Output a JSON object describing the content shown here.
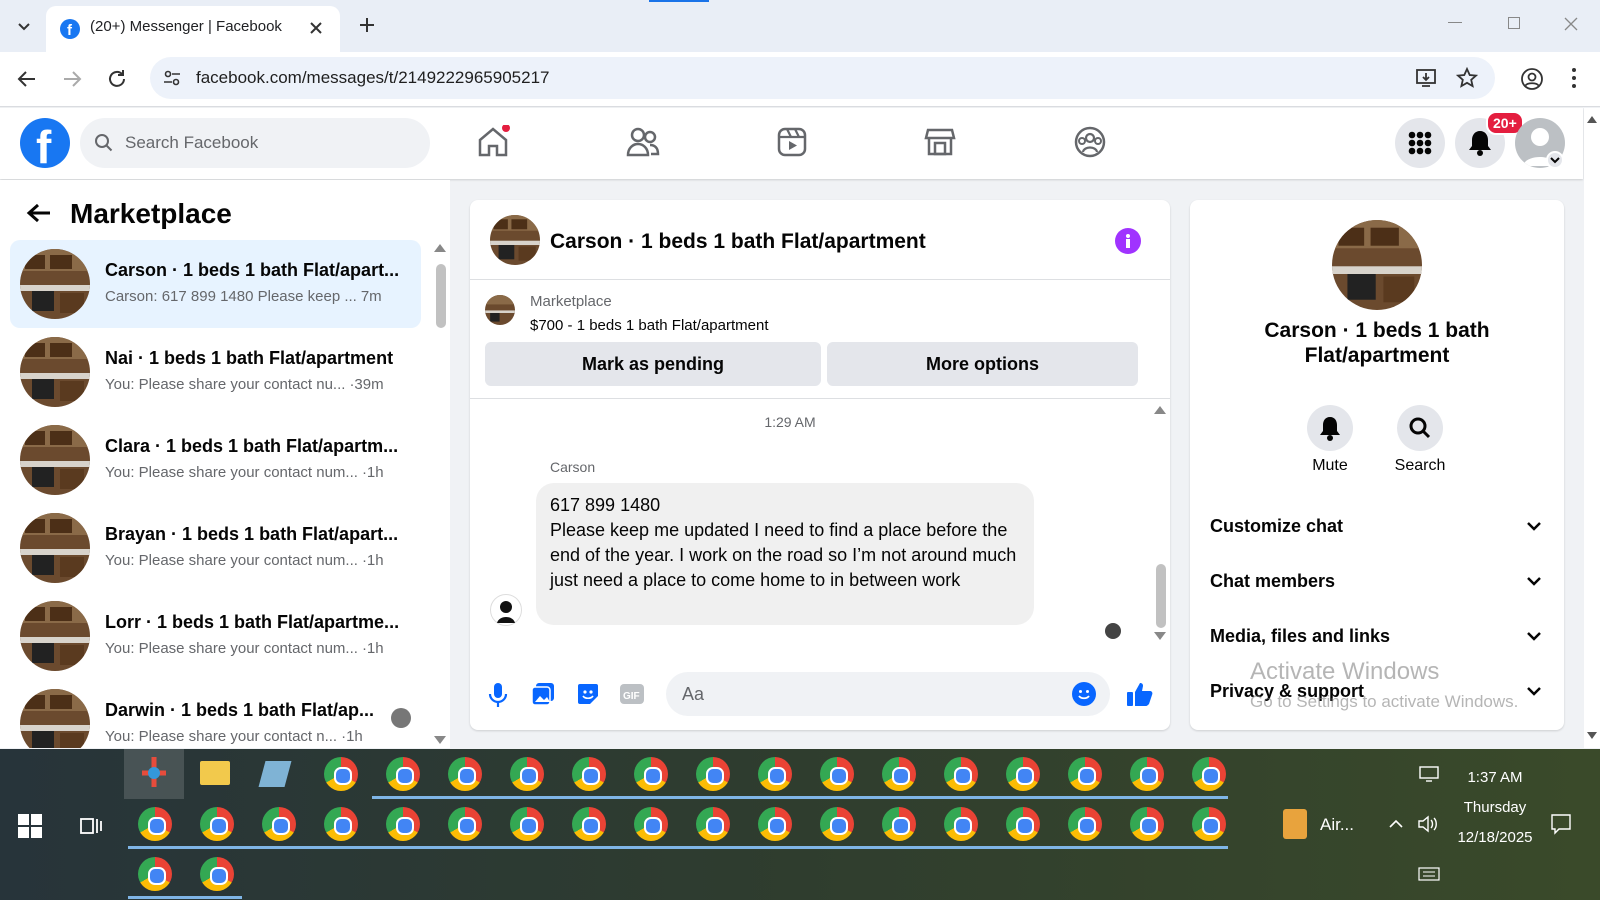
{
  "browser": {
    "tab_title": "(20+) Messenger | Facebook",
    "url": "facebook.com/messages/t/2149222965905217"
  },
  "fb": {
    "search_placeholder": "Search Facebook",
    "notif_badge": "20+",
    "brand_color": "#1877f2"
  },
  "left": {
    "heading": "Marketplace",
    "conversations": [
      {
        "name": "Carson · 1 beds 1 bath Flat/apart...",
        "preview": "Carson: 617 899 1480 Please keep ...",
        "time": "7m"
      },
      {
        "name": "Nai · 1 beds 1 bath Flat/apartment",
        "preview": "You: Please share your contact nu...",
        "time": "·39m"
      },
      {
        "name": "Clara · 1 beds 1 bath Flat/apartm...",
        "preview": "You: Please share your contact num...",
        "time": "·1h"
      },
      {
        "name": "Brayan · 1 beds 1 bath Flat/apart...",
        "preview": "You: Please share your contact num...",
        "time": "·1h"
      },
      {
        "name": "Lorr · 1 beds 1 bath Flat/apartme...",
        "preview": "You: Please share your contact num...",
        "time": "·1h"
      },
      {
        "name": "Darwin · 1 beds 1 bath Flat/ap...",
        "preview": "You: Please share your contact n...",
        "time": "·1h"
      }
    ]
  },
  "chat": {
    "title": "Carson · 1 beds 1 bath Flat/apartment",
    "listing_source": "Marketplace",
    "listing_title": "$700 - 1 beds 1 bath Flat/apartment",
    "mark_pending": "Mark as pending",
    "more_options": "More options",
    "timestamp": "1:29 AM",
    "sender": "Carson",
    "message_line1": "617 899 1480",
    "message_body": "Please keep me updated I need to find a place before the end of the year. I work on the road so I’m not around much just need a place to come home to in between work",
    "composer_placeholder": "Aa"
  },
  "right": {
    "name": "Carson · 1 beds 1 bath Flat/apartment",
    "mute": "Mute",
    "search": "Search",
    "sections": [
      "Customize chat",
      "Chat members",
      "Media, files and links",
      "Privacy & support"
    ]
  },
  "watermark": {
    "line1": "Activate Windows",
    "line2": "Go to Settings to activate Windows."
  },
  "taskbar": {
    "weather": "Air...",
    "time": "1:37 AM",
    "day": "Thursday",
    "date": "12/18/2025"
  }
}
